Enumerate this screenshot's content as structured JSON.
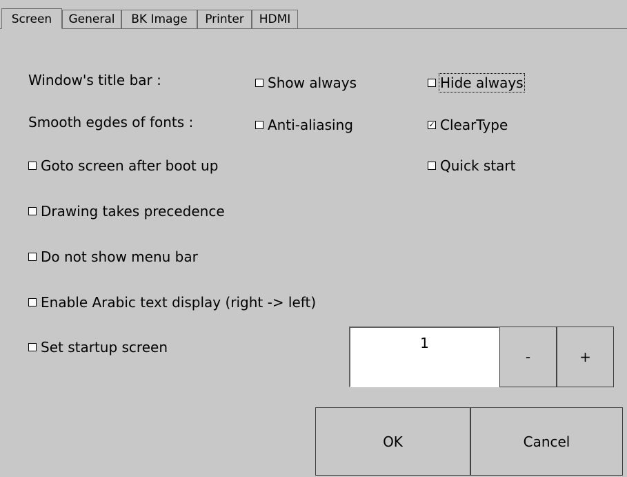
{
  "tabs": [
    "Screen",
    "General",
    "BK Image",
    "Printer",
    "HDMI"
  ],
  "rows": {
    "title_bar_label": "Window's title bar :",
    "smooth_label": "Smooth egdes of fonts :"
  },
  "checkboxes": {
    "show_always": {
      "label": "Show always",
      "checked": false
    },
    "hide_always": {
      "label": "Hide always",
      "checked": false
    },
    "anti_aliasing": {
      "label": "Anti-aliasing",
      "checked": false
    },
    "cleartype": {
      "label": "ClearType",
      "checked": true
    },
    "goto_screen": {
      "label": "Goto screen after boot up",
      "checked": false
    },
    "quick_start": {
      "label": "Quick start",
      "checked": false
    },
    "drawing_precedence": {
      "label": "Drawing takes precedence",
      "checked": false
    },
    "no_menu_bar": {
      "label": "Do not show menu bar",
      "checked": false
    },
    "arabic_text": {
      "label": "Enable Arabic text display (right -> left)",
      "checked": false
    },
    "startup_screen": {
      "label": "Set startup screen",
      "checked": false
    }
  },
  "startup_value": "1",
  "buttons": {
    "minus": "-",
    "plus": "+",
    "ok": "OK",
    "cancel": "Cancel"
  }
}
